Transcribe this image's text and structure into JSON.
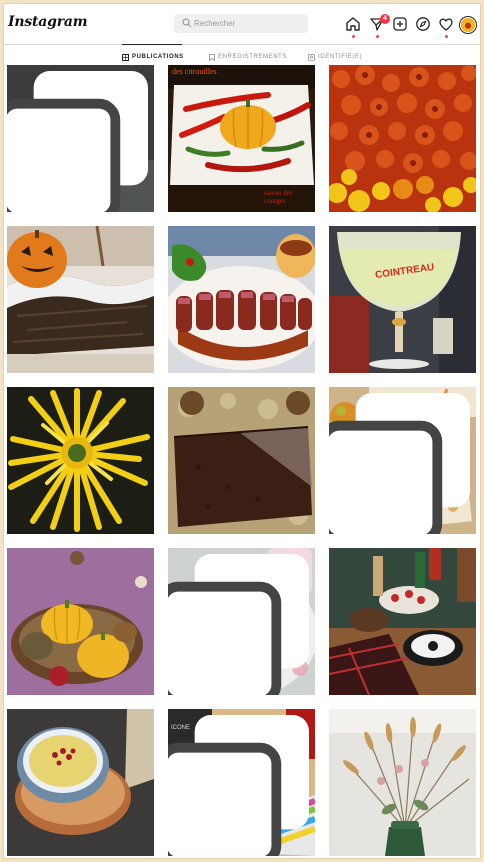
{
  "app": {
    "logo": "Instagram"
  },
  "search": {
    "placeholder": "Rechercher"
  },
  "notifications": {
    "count": "4"
  },
  "tabs": [
    {
      "label": "PUBLICATIONS",
      "active": true
    },
    {
      "label": "ENREGISTREMENTS",
      "active": false
    },
    {
      "label": "IDENTIFIÉ(E)",
      "active": false
    }
  ],
  "posts": [
    {
      "subject": "apples-in-glasses",
      "multi": true
    },
    {
      "subject": "pumpkin-with-peppers",
      "caption_top": "des citrouilles",
      "caption_bottom": "saison des courges",
      "multi": false
    },
    {
      "subject": "orange-marigolds",
      "multi": false
    },
    {
      "subject": "halloween-log-cake",
      "multi": false
    },
    {
      "subject": "duck-breast-plate",
      "multi": false
    },
    {
      "subject": "cointreau-cocktail",
      "glass_text": "COINTREAU",
      "multi": false
    },
    {
      "subject": "yellow-chrysanthemum",
      "multi": false
    },
    {
      "subject": "chocolate-cake",
      "multi": false
    },
    {
      "subject": "autumn-drink",
      "multi": true
    },
    {
      "subject": "pumpkin-basket",
      "multi": false
    },
    {
      "subject": "madeleines",
      "multi": true
    },
    {
      "subject": "autumn-table",
      "multi": false
    },
    {
      "subject": "soup-bowl",
      "multi": false
    },
    {
      "subject": "chocolate-chip-loaf",
      "jar_text": "ICONE",
      "multi": true
    },
    {
      "subject": "dried-flowers-vase",
      "multi": false
    }
  ]
}
